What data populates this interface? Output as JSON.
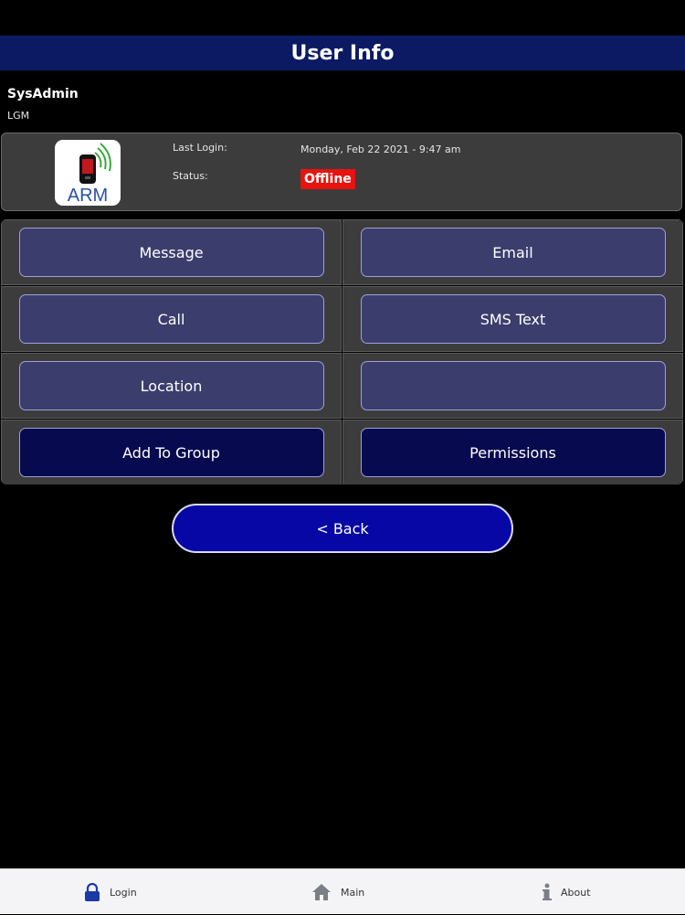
{
  "header": {
    "title": "User Info"
  },
  "user": {
    "name": "SysAdmin",
    "org": "LGM"
  },
  "info": {
    "app_icon_text": "ARM",
    "last_login_label": "Last Login:",
    "last_login_value": "Monday, Feb 22 2021 - 9:47 am",
    "status_label": "Status:",
    "status_value": "Offline",
    "status_color": "#e8120f"
  },
  "actions": [
    {
      "label": "Message"
    },
    {
      "label": "Email"
    },
    {
      "label": "Call"
    },
    {
      "label": "SMS Text"
    },
    {
      "label": "Location"
    },
    {
      "label": ""
    },
    {
      "label": "Add To Group"
    },
    {
      "label": "Permissions"
    }
  ],
  "back_label": "< Back",
  "tabbar": {
    "items": [
      {
        "label": "Login",
        "icon": "lock-icon"
      },
      {
        "label": "Main",
        "icon": "home-icon"
      },
      {
        "label": "About",
        "icon": "info-icon"
      }
    ]
  },
  "colors": {
    "header_bg": "#0b1a63",
    "back_button": "#0707a5",
    "lock_icon": "#1a3aa6"
  }
}
